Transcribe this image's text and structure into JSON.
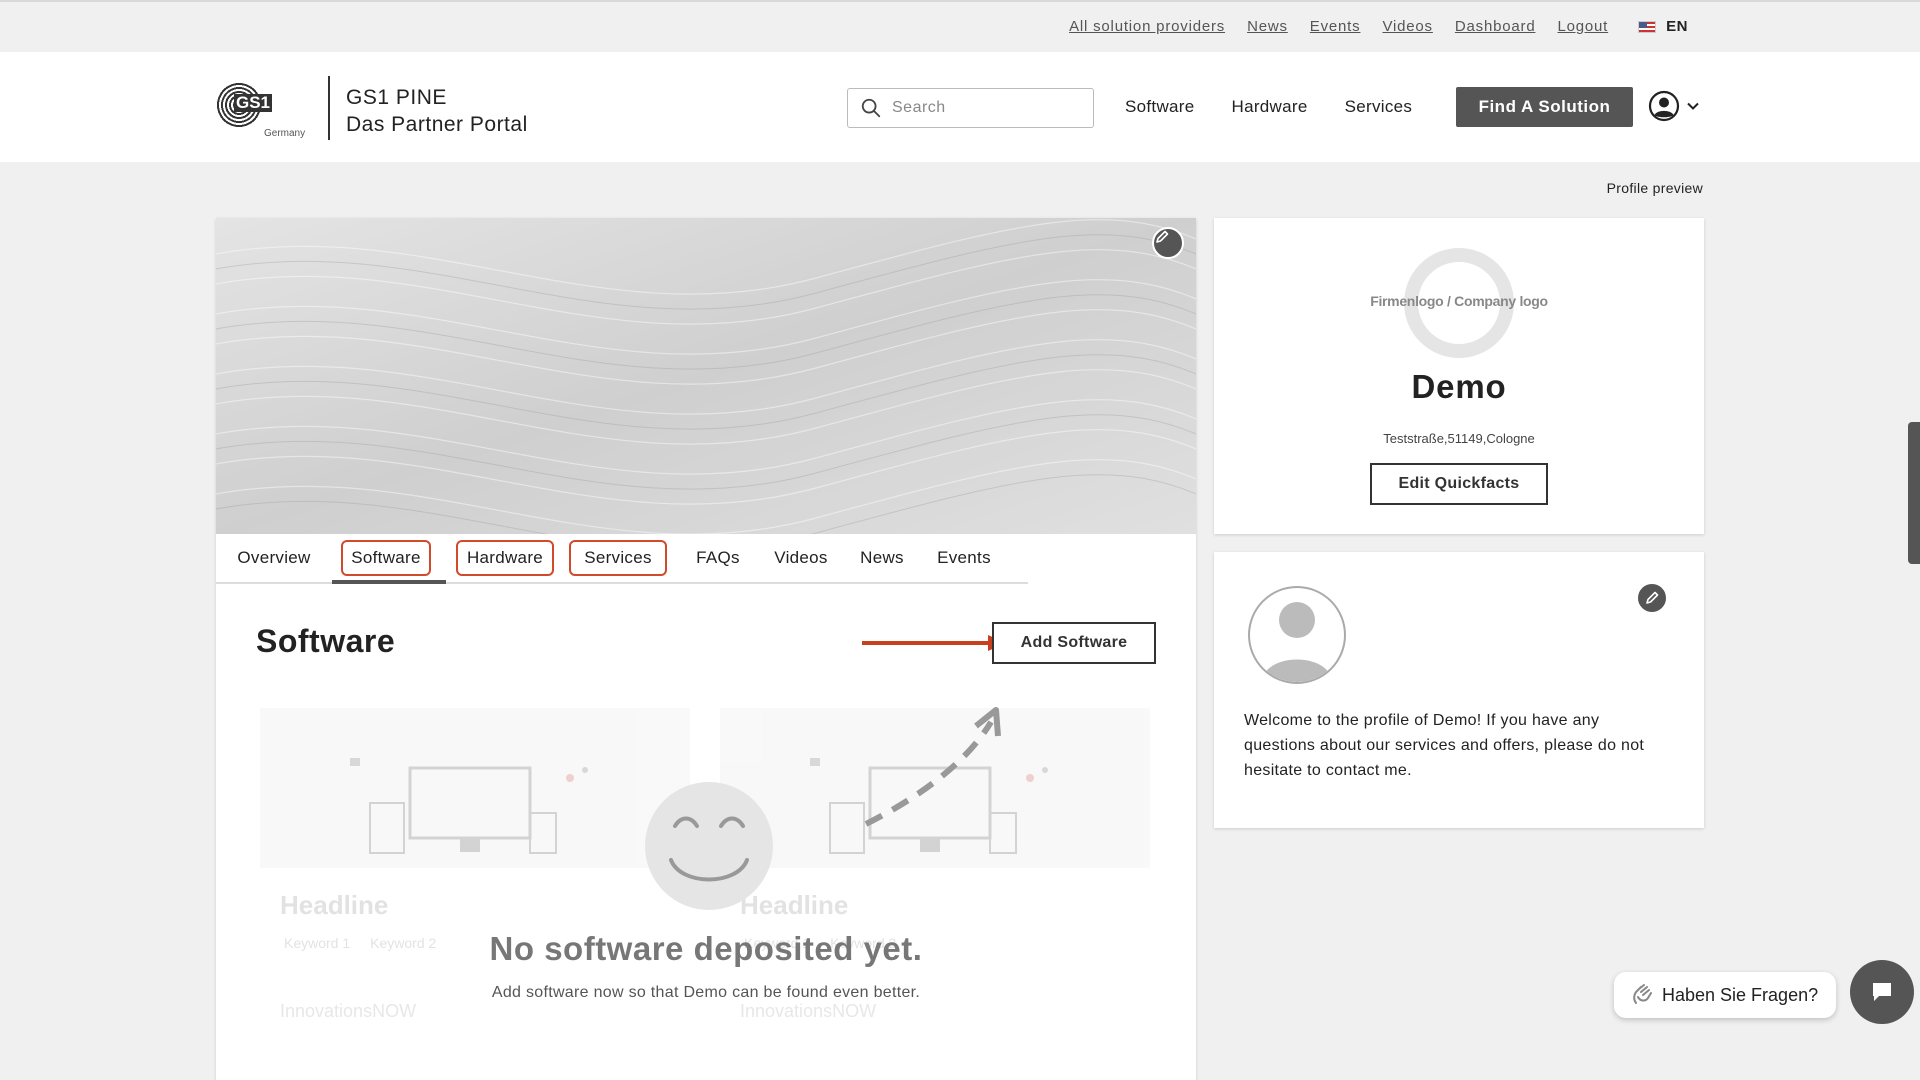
{
  "top_links": [
    "All solution providers",
    "News",
    "Events",
    "Videos",
    "Dashboard",
    "Logout"
  ],
  "language": "EN",
  "logo": {
    "mark": "GS1",
    "region": "Germany"
  },
  "brand": {
    "line1": "GS1 PINE",
    "line2": "Das Partner Portal"
  },
  "search": {
    "placeholder": "Search"
  },
  "main_nav": [
    "Software",
    "Hardware",
    "Services"
  ],
  "find_button": "Find A Solution",
  "profile_preview_label": "Profile preview",
  "tabs": [
    "Overview",
    "Software",
    "Hardware",
    "Services",
    "FAQs",
    "Videos",
    "News",
    "Events"
  ],
  "active_tab": "Software",
  "section": {
    "title": "Software",
    "add_button": "Add Software",
    "placeholder_cards": [
      {
        "headline": "Headline",
        "keywords": [
          "Keyword 1",
          "Keyword 2"
        ],
        "logo_text": "InnovationsNOW"
      },
      {
        "headline": "Headline",
        "keywords": [
          "Keyword 1",
          "Keyword 2"
        ],
        "logo_text": "InnovationsNOW"
      }
    ],
    "empty_title": "No software deposited yet.",
    "empty_subtitle": "Add software now so that Demo can be found even better."
  },
  "quickfacts": {
    "logo_placeholder": "Firmenlogo / Company logo",
    "company_name": "Demo",
    "address": "Teststraße,51149,Cologne",
    "edit_button": "Edit Quickfacts"
  },
  "contact": {
    "welcome_text": "Welcome to the profile of Demo! If you have any questions about our services and offers, please do not hesitate to contact me."
  },
  "chat": {
    "label": "Haben Sie Fragen?"
  },
  "colors": {
    "accent_outline": "#d14b2a",
    "dark_button": "#555555"
  }
}
